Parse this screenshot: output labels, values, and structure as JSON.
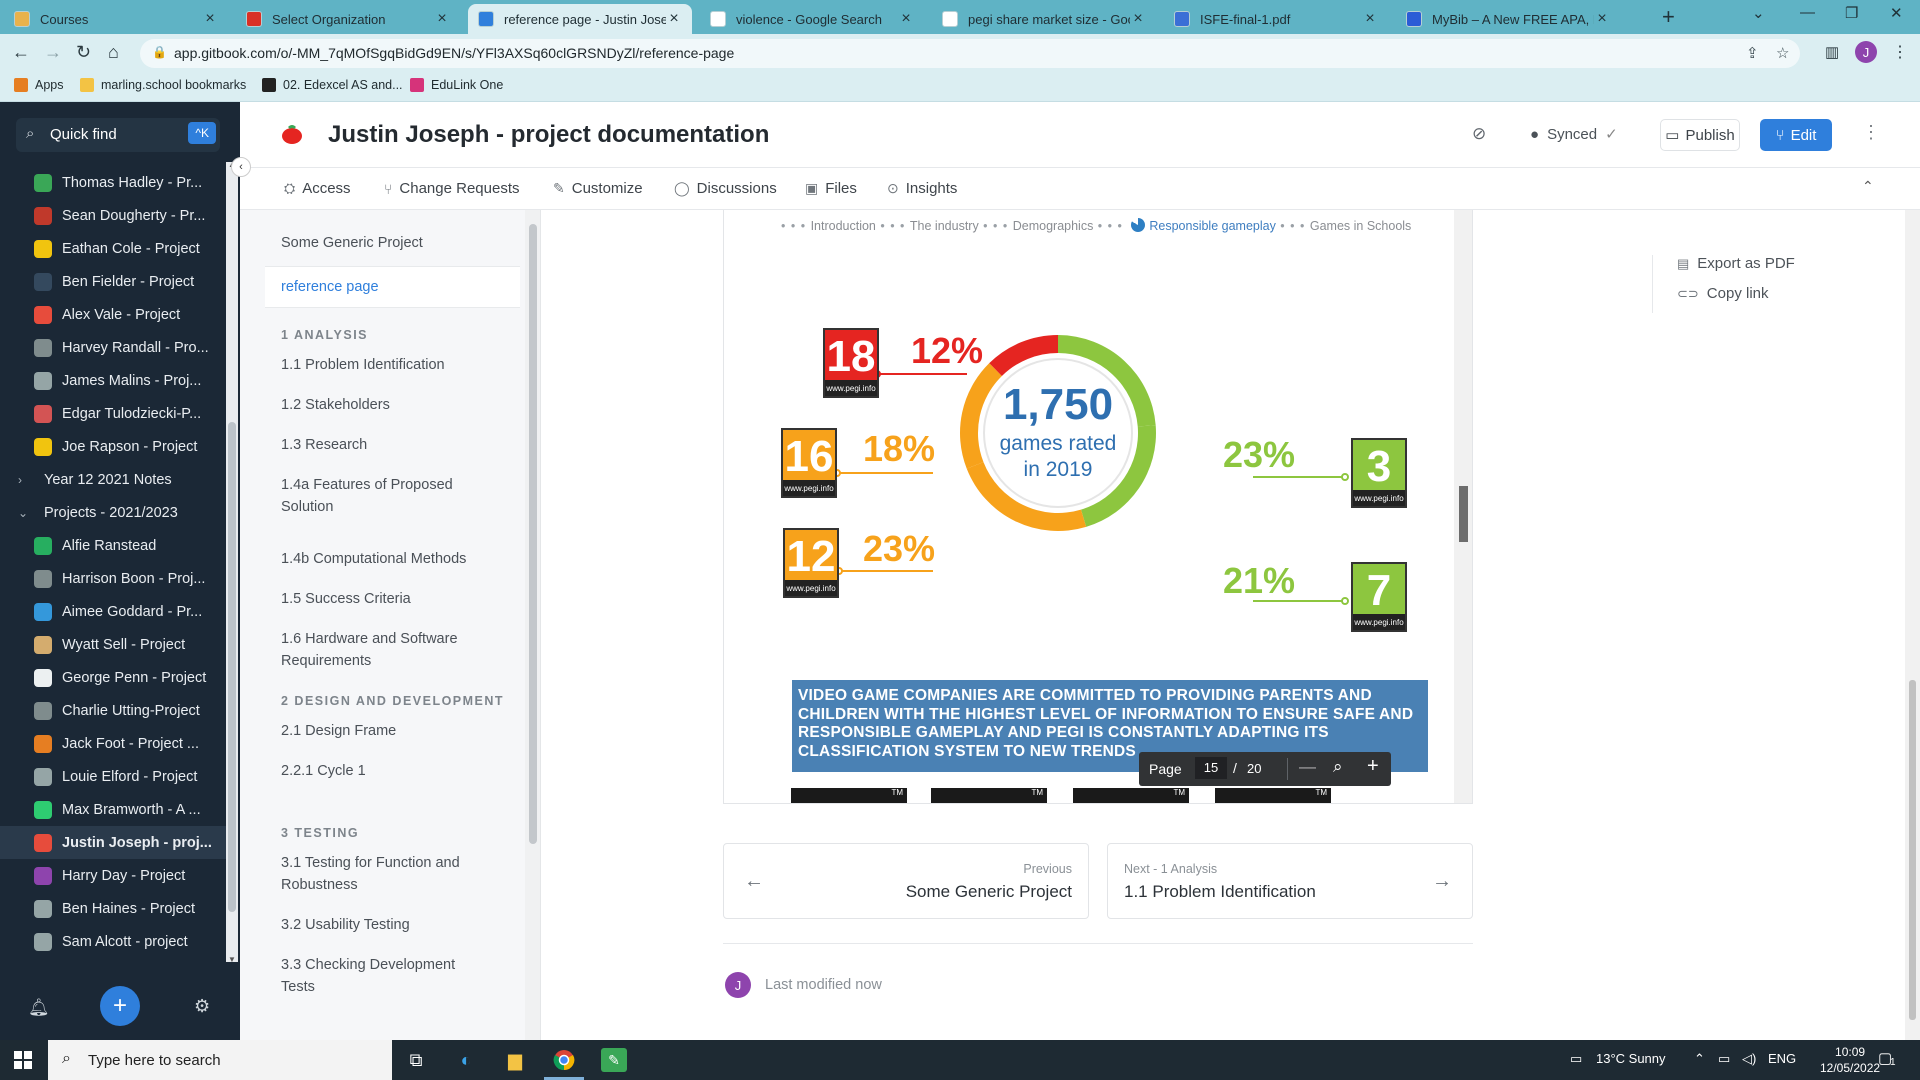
{
  "browser": {
    "tabs": [
      {
        "title": "Courses",
        "icon": "courses-favicon",
        "color": "#e8b24c"
      },
      {
        "title": "Select Organization",
        "icon": "gitbook-favicon",
        "color": "#d93025"
      },
      {
        "title": "reference page - Justin Joseph -",
        "icon": "gitbook-favicon",
        "color": "#2f7fdc"
      },
      {
        "title": "violence - Google Search",
        "icon": "google-favicon",
        "color": "#ffffff"
      },
      {
        "title": "pegi share market size - Google",
        "icon": "google-favicon",
        "color": "#ffffff"
      },
      {
        "title": "ISFE-final-1.pdf",
        "icon": "pdf-favicon",
        "color": "#3b6fd6"
      },
      {
        "title": "MyBib – A New FREE APA, H",
        "icon": "mybib-favicon",
        "color": "#2b5cd6"
      }
    ],
    "active_tab": 2,
    "url": "app.gitbook.com/o/-MM_7qMOfSgqBidGd9EN/s/YFl3AXSq60clGRSNDyZl/reference-page",
    "bookmarks": [
      {
        "label": "Apps",
        "icon": "apps-grid-icon"
      },
      {
        "label": "marling.school bookmarks",
        "icon": "folder-icon"
      },
      {
        "label": "02. Edexcel AS and...",
        "icon": "edexcel-icon"
      },
      {
        "label": "EduLink One",
        "icon": "edulink-icon"
      }
    ],
    "profile_initial": "J"
  },
  "sidebar": {
    "quick_find": "Quick find",
    "shortcut": "^K",
    "items": [
      {
        "label": "Thomas Hadley - Pr...",
        "type": "page",
        "icon": "green-book-icon",
        "color": "#3aa757"
      },
      {
        "label": "Sean Dougherty - Pr...",
        "type": "page",
        "icon": "books-icon",
        "color": "#c0392b"
      },
      {
        "label": "Eathan Cole - Project",
        "type": "page",
        "icon": "smile-icon",
        "color": "#f1c40f"
      },
      {
        "label": "Ben Fielder - Project",
        "type": "page",
        "icon": "car-icon",
        "color": "#34495e"
      },
      {
        "label": "Alex Vale - Project",
        "type": "page",
        "icon": "mushroom-icon",
        "color": "#e74c3c"
      },
      {
        "label": "Harvey Randall - Pro...",
        "type": "page",
        "icon": "laptop-icon",
        "color": "#7f8c8d"
      },
      {
        "label": "James Malins - Proj...",
        "type": "page",
        "icon": "raccoon-icon",
        "color": "#95a5a6"
      },
      {
        "label": "Edgar Tulodziecki-P...",
        "type": "page",
        "icon": "flag-icon",
        "color": "#d35454"
      },
      {
        "label": "Joe Rapson - Project",
        "type": "page",
        "icon": "smile-icon",
        "color": "#f1c40f"
      },
      {
        "label": "Year 12 2021 Notes",
        "type": "group",
        "expanded": false
      },
      {
        "label": "Projects - 2021/2023",
        "type": "group",
        "expanded": true
      },
      {
        "label": "Alfie Ranstead",
        "type": "page",
        "icon": "art-icon",
        "color": "#27ae60"
      },
      {
        "label": "Harrison Boon - Proj...",
        "type": "page",
        "icon": "robot-icon",
        "color": "#7f8c8d"
      },
      {
        "label": "Aimee Goddard - Pr...",
        "type": "page",
        "icon": "infinity-icon",
        "color": "#3498db"
      },
      {
        "label": "Wyatt Sell - Project",
        "type": "page",
        "icon": "telescope-icon",
        "color": "#d4ac6e"
      },
      {
        "label": "George Penn - Project",
        "type": "page",
        "icon": "skull-icon",
        "color": "#ecf0f1"
      },
      {
        "label": "Charlie Utting-Project",
        "type": "page",
        "icon": "laptop-icon",
        "color": "#7f8c8d"
      },
      {
        "label": "Jack Foot - Project ...",
        "type": "page",
        "icon": "rocket-icon",
        "color": "#e67e22"
      },
      {
        "label": "Louie Elford - Project",
        "type": "page",
        "icon": "globe-icon",
        "color": "#95a5a6"
      },
      {
        "label": "Max Bramworth - A ...",
        "type": "page",
        "icon": "alien-icon",
        "color": "#2ecc71"
      },
      {
        "label": "Justin Joseph - proj...",
        "type": "page",
        "icon": "chili-icon",
        "color": "#e74c3c",
        "active": true
      },
      {
        "label": "Harry Day - Project",
        "type": "page",
        "icon": "pen-icon",
        "color": "#8e44ad"
      },
      {
        "label": "Ben Haines - Project",
        "type": "page",
        "icon": "tools-icon",
        "color": "#95a5a6"
      },
      {
        "label": "Sam Alcott - project",
        "type": "page",
        "icon": "tools-icon",
        "color": "#95a5a6"
      }
    ]
  },
  "header": {
    "title": "Justin Joseph - project documentation",
    "synced": "Synced",
    "publish": "Publish",
    "edit": "Edit",
    "nav": [
      "Access",
      "Change Requests",
      "Customize",
      "Discussions",
      "Files",
      "Insights"
    ]
  },
  "toc": {
    "items": [
      {
        "label": "Some Generic Project",
        "kind": "page"
      },
      {
        "label": "reference page",
        "kind": "page",
        "active": true
      },
      {
        "label": "1 ANALYSIS",
        "kind": "section"
      },
      {
        "label": "1.1 Problem Identification",
        "kind": "page"
      },
      {
        "label": "1.2 Stakeholders",
        "kind": "page"
      },
      {
        "label": "1.3 Research",
        "kind": "page"
      },
      {
        "label": "1.4a Features of Proposed Solution",
        "kind": "page"
      },
      {
        "label": "1.4b Computational Methods",
        "kind": "page"
      },
      {
        "label": "1.5 Success Criteria",
        "kind": "page"
      },
      {
        "label": "1.6 Hardware and Software Requirements",
        "kind": "page"
      },
      {
        "label": "2 DESIGN AND DEVELOPMENT",
        "kind": "section"
      },
      {
        "label": "2.1 Design Frame",
        "kind": "page"
      },
      {
        "label": "2.2.1 Cycle 1",
        "kind": "page"
      },
      {
        "label": "3 TESTING",
        "kind": "section"
      },
      {
        "label": "3.1 Testing for Function and Robustness",
        "kind": "page"
      },
      {
        "label": "3.2 Usability Testing",
        "kind": "page"
      },
      {
        "label": "3.3 Checking Development Tests",
        "kind": "page"
      }
    ]
  },
  "pdf": {
    "breadcrumb": [
      "Introduction",
      "The industry",
      "Demographics",
      "Responsible gameplay",
      "Games in Schools"
    ],
    "breadcrumb_active": 3,
    "donut": {
      "number": "1,750",
      "line1": "games rated",
      "line2": "in 2019",
      "segments": [
        {
          "rating": "3",
          "percent": 23,
          "color": "#8dc63f"
        },
        {
          "rating": "7",
          "percent": 21,
          "color": "#8dc63f"
        },
        {
          "rating": "12",
          "percent": 23,
          "color": "#f7a21b"
        },
        {
          "rating": "16",
          "percent": 18,
          "color": "#f7a21b"
        },
        {
          "rating": "18",
          "percent": 12,
          "color": "#e52521"
        }
      ]
    },
    "ratings": [
      {
        "rating": "18",
        "label": "12%",
        "color": "#e52521",
        "site": "www.pegi.info"
      },
      {
        "rating": "16",
        "label": "18%",
        "color": "#f7a21b",
        "site": "www.pegi.info"
      },
      {
        "rating": "12",
        "label": "23%",
        "color": "#f7a21b",
        "site": "www.pegi.info"
      },
      {
        "rating": "3",
        "label": "23%",
        "color": "#8dc63f",
        "site": "www.pegi.info"
      },
      {
        "rating": "7",
        "label": "21%",
        "color": "#8dc63f",
        "site": "www.pegi.info"
      }
    ],
    "banner": "VIDEO GAME COMPANIES ARE COMMITTED TO PROVIDING PARENTS AND CHILDREN WITH THE HIGHEST LEVEL OF INFORMATION TO ENSURE SAFE AND RESPONSIBLE GAMEPLAY AND PEGI IS CONSTANTLY ADAPTING ITS CLASSIFICATION SYSTEM TO NEW TRENDS",
    "toolbar": {
      "page_label": "Page",
      "page": "15",
      "separator": "/",
      "total": "20"
    }
  },
  "pager": {
    "prev_label": "Previous",
    "prev_title": "Some Generic Project",
    "next_label": "Next - 1 Analysis",
    "next_title": "1.1 Problem Identification"
  },
  "footer": {
    "avatar": "J",
    "last_modified": "Last modified now"
  },
  "rightpanel": {
    "export": "Export as PDF",
    "copy": "Copy link"
  },
  "taskbar": {
    "search_placeholder": "Type here to search",
    "weather": "13°C  Sunny",
    "lang": "ENG",
    "time": "10:09",
    "date": "12/05/2022",
    "notifications": "1"
  }
}
